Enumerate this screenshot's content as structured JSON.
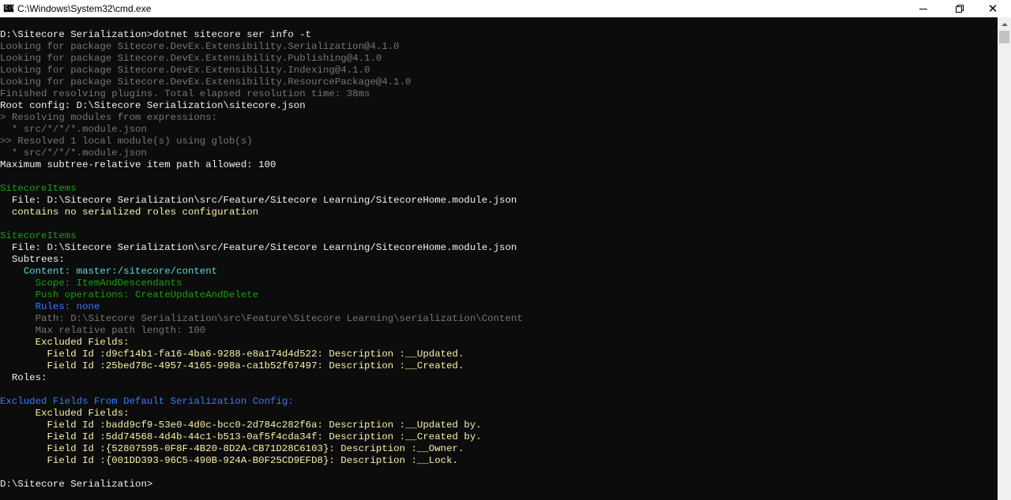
{
  "window": {
    "title": "C:\\Windows\\System32\\cmd.exe",
    "icon_label": "C:\\"
  },
  "console_lines": [
    {
      "text": "",
      "color": "white"
    },
    {
      "text": "D:\\Sitecore Serialization>dotnet sitecore ser info -t",
      "color": "white"
    },
    {
      "text": "Looking for package Sitecore.DevEx.Extensibility.Serialization@4.1.0",
      "color": "gray"
    },
    {
      "text": "Looking for package Sitecore.DevEx.Extensibility.Publishing@4.1.0",
      "color": "gray"
    },
    {
      "text": "Looking for package Sitecore.DevEx.Extensibility.Indexing@4.1.0",
      "color": "gray"
    },
    {
      "text": "Looking for package Sitecore.DevEx.Extensibility.ResourcePackage@4.1.0",
      "color": "gray"
    },
    {
      "text": "Finished resolving plugins. Total elapsed resolution time: 38ms",
      "color": "gray"
    },
    {
      "text": "Root config: D:\\Sitecore Serialization\\sitecore.json",
      "color": "white"
    },
    {
      "text": "> Resolving modules from expressions:",
      "color": "gray"
    },
    {
      "text": "  * src/*/*/*.module.json",
      "color": "gray"
    },
    {
      "text": ">> Resolved 1 local module(s) using glob(s)",
      "color": "gray"
    },
    {
      "text": "  * src/*/*/*.module.json",
      "color": "gray"
    },
    {
      "text": "Maximum subtree-relative item path allowed: 100",
      "color": "white"
    },
    {
      "text": "",
      "color": "white"
    },
    {
      "text": "SitecoreItems",
      "color": "green"
    },
    {
      "text": "  File: D:\\Sitecore Serialization\\src/Feature/Sitecore Learning/SitecoreHome.module.json",
      "color": "white"
    },
    {
      "text": "  contains no serialized roles configuration",
      "color": "yellow"
    },
    {
      "text": "",
      "color": "white"
    },
    {
      "text": "SitecoreItems",
      "color": "green"
    },
    {
      "text": "  File: D:\\Sitecore Serialization\\src/Feature/Sitecore Learning/SitecoreHome.module.json",
      "color": "white"
    },
    {
      "text": "  Subtrees:",
      "color": "white"
    },
    {
      "text": "    Content: master:/sitecore/content",
      "color": "cyan"
    },
    {
      "text": "      Scope: ItemAndDescendants",
      "color": "green"
    },
    {
      "text": "      Push operations: CreateUpdateAndDelete",
      "color": "green"
    },
    {
      "text": "      Rules: none",
      "color": "blue"
    },
    {
      "text": "      Path: D:\\Sitecore Serialization\\src\\Feature\\Sitecore Learning\\serialization\\Content",
      "color": "gray"
    },
    {
      "text": "      Max relative path length: 100",
      "color": "gray"
    },
    {
      "text": "      Excluded Fields:",
      "color": "yellow"
    },
    {
      "text": "        Field Id :d9cf14b1-fa16-4ba6-9288-e8a174d4d522: Description :__Updated.",
      "color": "yellow"
    },
    {
      "text": "        Field Id :25bed78c-4957-4165-998a-ca1b52f67497: Description :__Created.",
      "color": "yellow"
    },
    {
      "text": "  Roles:",
      "color": "white"
    },
    {
      "text": "",
      "color": "white"
    },
    {
      "text": "Excluded Fields From Default Serialization Config:",
      "color": "blue"
    },
    {
      "text": "      Excluded Fields:",
      "color": "yellow"
    },
    {
      "text": "        Field Id :badd9cf9-53e0-4d0c-bcc0-2d784c282f6a: Description :__Updated by.",
      "color": "yellow"
    },
    {
      "text": "        Field Id :5dd74568-4d4b-44c1-b513-0af5f4cda34f: Description :__Created by.",
      "color": "yellow"
    },
    {
      "text": "        Field Id :{52807595-0F8F-4B20-8D2A-CB71D28C6103}: Description :__Owner.",
      "color": "yellow"
    },
    {
      "text": "        Field Id :{001DD393-96C5-490B-924A-B0F25CD9EFD8}: Description :__Lock.",
      "color": "yellow"
    },
    {
      "text": "",
      "color": "white"
    },
    {
      "text": "D:\\Sitecore Serialization>",
      "color": "white"
    }
  ]
}
